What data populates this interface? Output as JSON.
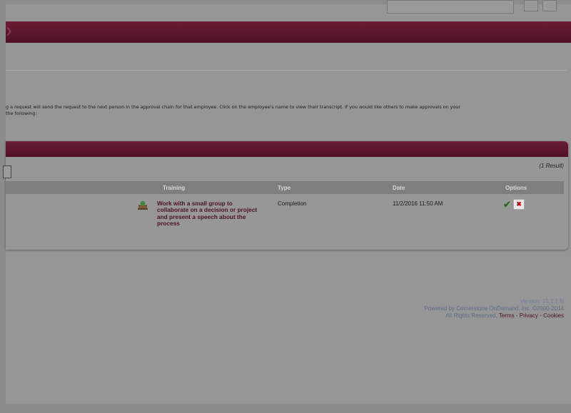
{
  "intro_lines": [
    "g a request will send the request to the next person in the approval chain for that employee. Click on the employee's name to view their transcript. If you would like others to make approvals on your",
    "the following:"
  ],
  "results": {
    "count_label": "(1 Result)",
    "columns": {
      "training": "Training",
      "type": "Type",
      "date": "Date",
      "options": "Options"
    },
    "rows": [
      {
        "training": "Work with a small group to collaborate on a decision or project and present a speech about the process",
        "type": "Completion",
        "date": "11/2/2016 11:50 AM",
        "approve_icon": "check-icon",
        "deny_icon": "x-icon"
      }
    ]
  },
  "footer": {
    "version": "Version: 15.2.1.N",
    "powered": "Powered by Cornerstone OnDemand, Inc. ©2000-2014",
    "rights": "All Rights Reserved.",
    "links": [
      "Terms",
      "Privacy",
      "Cookies"
    ]
  },
  "colors": {
    "brand": "#4e1126",
    "approve": "#2a6a1c",
    "deny": "#b01010",
    "overlay": "#969696"
  }
}
